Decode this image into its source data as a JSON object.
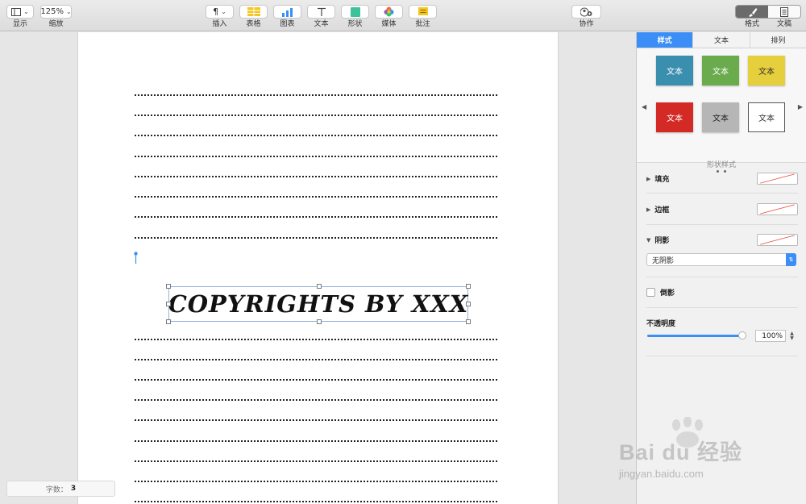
{
  "toolbar": {
    "view_label": "显示",
    "zoom_value": "125%",
    "zoom_label": "缩放",
    "insert_label": "插入",
    "table_label": "表格",
    "chart_label": "图表",
    "text_label": "文本",
    "shape_label": "形状",
    "media_label": "媒体",
    "comment_label": "批注",
    "collaborate_label": "协作",
    "format_label": "格式",
    "document_label": "文稿"
  },
  "document": {
    "wordart_text": "COPYRIGHTS BY XXX",
    "word_count_label": "字数：",
    "word_count_value": "3"
  },
  "inspector": {
    "tabs": [
      "样式",
      "文本",
      "排列"
    ],
    "style_tiles": [
      {
        "label": "文本",
        "color": "#3b8fae"
      },
      {
        "label": "文本",
        "color": "#6aab4e"
      },
      {
        "label": "文本",
        "color": "#e5cf3c"
      },
      {
        "label": "文本",
        "color": "#d42a25"
      },
      {
        "label": "文本",
        "color": "#b6b6b6"
      },
      {
        "label": "文本",
        "color": "#ffffff"
      }
    ],
    "shape_styles_label": "形状样式",
    "fill_label": "填充",
    "border_label": "边框",
    "shadow_label": "阴影",
    "shadow_value": "无阴影",
    "reflection_label": "倒影",
    "opacity_label": "不透明度",
    "opacity_value": "100%",
    "opacity_fraction": 1.0
  },
  "colors": {
    "accent": "#3a8ef6",
    "selection_border": "#8fb3de"
  }
}
